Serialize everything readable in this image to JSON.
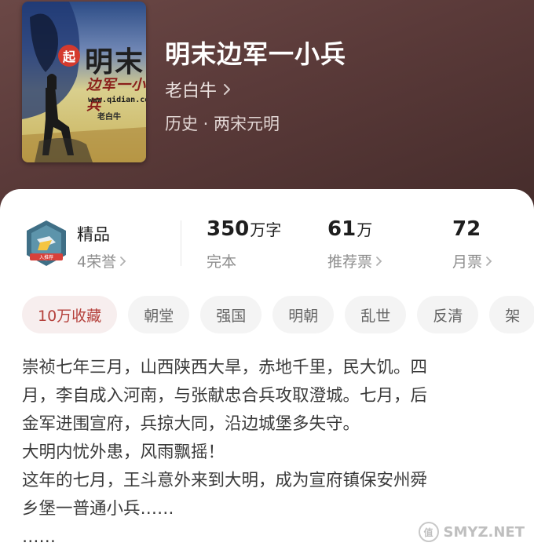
{
  "header": {
    "cover": {
      "badge": "起",
      "title": "明末",
      "subtitle": "边军一小兵",
      "site": "www.qidian.com",
      "author": "老白牛"
    },
    "title": "明末边军一小兵",
    "author": "老白牛",
    "genre": "历史 · 两宋元明"
  },
  "stats": {
    "honor": {
      "label": "精品",
      "sub": "4荣誉"
    },
    "words": {
      "value": "350",
      "unit": "万字",
      "sub": "完本"
    },
    "recommend": {
      "value": "61",
      "unit": "万",
      "sub": "推荐票"
    },
    "monthly": {
      "value": "72",
      "sub": "月票"
    }
  },
  "tags": [
    "10万收藏",
    "朝堂",
    "强国",
    "明朝",
    "乱世",
    "反清",
    "架"
  ],
  "description": [
    "崇祯七年三月，山西陕西大旱，赤地千里，民大饥。四",
    "月，李自成入河南，与张献忠合兵攻取澄城。七月，后",
    "金军进围宣府，兵掠大同，沿边城堡多失守。",
    "大明内忧外患，风雨飘摇！",
    "这年的七月，王斗意外来到大明，成为宣府镇保安州舜",
    "乡堡一普通小兵……",
    "……"
  ],
  "watermark": {
    "icon": "值",
    "text": "SMYZ.NET"
  },
  "colors": {
    "header_bg": "#5a3a39",
    "tag_highlight_text": "#b5413c",
    "tag_highlight_bg": "#f7eeee"
  }
}
